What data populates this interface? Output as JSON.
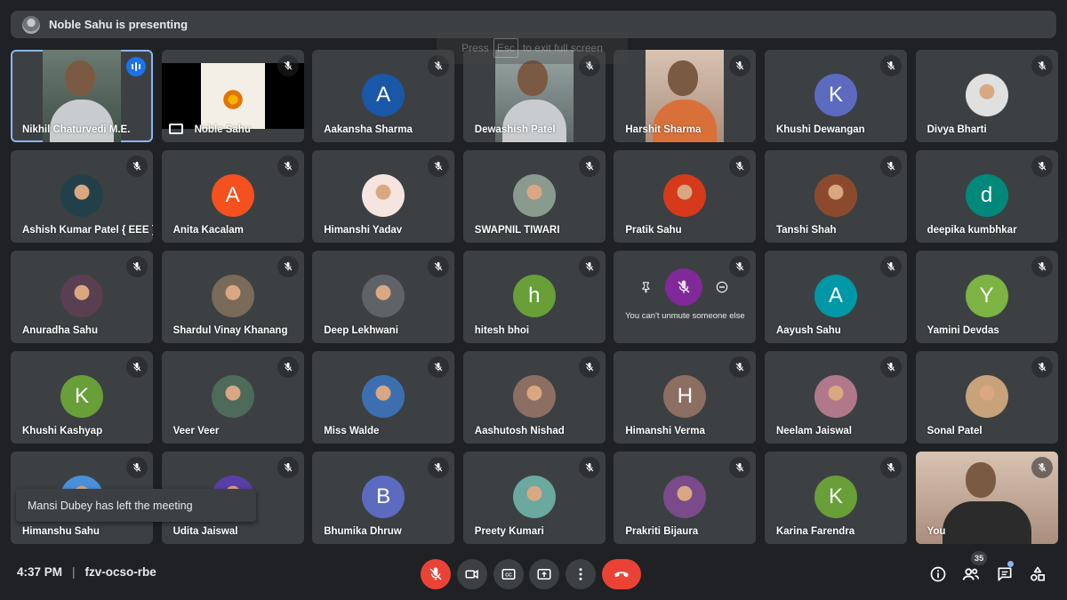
{
  "banner": {
    "text": "Noble Sahu is presenting"
  },
  "fullscreen_hint": {
    "press": "Press",
    "key": "Esc",
    "rest": "to exit full screen"
  },
  "participants": [
    {
      "name": "Nikhil Chaturvedi M.E.",
      "kind": "video",
      "speaking": true
    },
    {
      "name": "Noble Sahu",
      "kind": "share"
    },
    {
      "name": "Aakansha Sharma",
      "kind": "letter",
      "letter": "A",
      "color": "#1a57a8"
    },
    {
      "name": "Dewashish Patel",
      "kind": "video",
      "style": "cam"
    },
    {
      "name": "Harshit Sharma",
      "kind": "video",
      "style": "room orange"
    },
    {
      "name": "Khushi Dewangan",
      "kind": "letter",
      "letter": "K",
      "color": "#5c6bc0"
    },
    {
      "name": "Divya Bharti",
      "kind": "photo",
      "color": "#e0e0e0"
    },
    {
      "name": "Ashish Kumar Patel { EEE }",
      "kind": "photo",
      "color": "#23404a"
    },
    {
      "name": "Anita Kacalam",
      "kind": "letter",
      "letter": "A",
      "color": "#f4511e"
    },
    {
      "name": "Himanshi Yadav",
      "kind": "photo",
      "color": "#f6e4e0"
    },
    {
      "name": "SWAPNIL TIWARI",
      "kind": "photo",
      "color": "#8a9a8e"
    },
    {
      "name": "Pratik Sahu",
      "kind": "photo",
      "color": "#d63a1a"
    },
    {
      "name": "Tanshi Shah",
      "kind": "photo",
      "color": "#8b4a2e"
    },
    {
      "name": "deepika kumbhkar",
      "kind": "letter",
      "letter": "d",
      "color": "#00897b"
    },
    {
      "name": "Anuradha Sahu",
      "kind": "photo",
      "color": "#5a3e52"
    },
    {
      "name": "Shardul Vinay Khanang",
      "kind": "photo",
      "color": "#7a6a5a"
    },
    {
      "name": "Deep Lekhwani",
      "kind": "photo",
      "color": "#5f6368"
    },
    {
      "name": "hitesh bhoi",
      "kind": "letter",
      "letter": "h",
      "color": "#689f38"
    },
    {
      "name": "",
      "kind": "popup",
      "popup_text": "You can't unmute someone else"
    },
    {
      "name": "Aayush Sahu",
      "kind": "letter",
      "letter": "A",
      "color": "#0097a7"
    },
    {
      "name": "Yamini Devdas",
      "kind": "letter",
      "letter": "Y",
      "color": "#7cb342"
    },
    {
      "name": "Khushi Kashyap",
      "kind": "letter",
      "letter": "K",
      "color": "#689f38"
    },
    {
      "name": "Veer Veer",
      "kind": "photo",
      "color": "#4d6a5a"
    },
    {
      "name": "Miss Walde",
      "kind": "photo",
      "color": "#3d6fb0"
    },
    {
      "name": "Aashutosh Nishad",
      "kind": "photo",
      "color": "#8d6e63"
    },
    {
      "name": "Himanshi Verma",
      "kind": "letter",
      "letter": "H",
      "color": "#8d6e63"
    },
    {
      "name": "Neelam Jaiswal",
      "kind": "photo",
      "color": "#b0788a"
    },
    {
      "name": "Sonal Patel",
      "kind": "photo",
      "color": "#c8a27a"
    },
    {
      "name": "Himanshu Sahu",
      "kind": "photo",
      "color": "#4a90d9"
    },
    {
      "name": "Udita Jaiswal",
      "kind": "photo",
      "color": "#5b3fa8"
    },
    {
      "name": "Bhumika Dhruw",
      "kind": "letter",
      "letter": "B",
      "color": "#5c6bc0"
    },
    {
      "name": "Preety Kumari",
      "kind": "photo",
      "color": "#6aa8a0"
    },
    {
      "name": "Prakriti Bijaura",
      "kind": "photo",
      "color": "#7a4a8a"
    },
    {
      "name": "Karina Farendra",
      "kind": "letter",
      "letter": "K",
      "color": "#689f38"
    },
    {
      "name": "You",
      "kind": "video",
      "style": "room dark",
      "self": true
    }
  ],
  "toast": "Mansi Dubey has left the meeting",
  "bottom": {
    "time": "4:37 PM",
    "meeting_code": "fzv-ocso-rbe",
    "participant_count": "35"
  },
  "icons": {
    "mic": "mic-off-icon",
    "camera": "camera-icon",
    "captions": "captions-icon",
    "present": "present-icon",
    "more": "more-vert-icon",
    "hangup": "hangup-icon",
    "info": "info-icon",
    "people": "people-icon",
    "chat": "chat-icon",
    "activities": "activities-icon"
  },
  "colors": {
    "background": "#202124",
    "tile": "#3c4043",
    "hangup": "#ea4335",
    "accent": "#8ab4f8"
  }
}
